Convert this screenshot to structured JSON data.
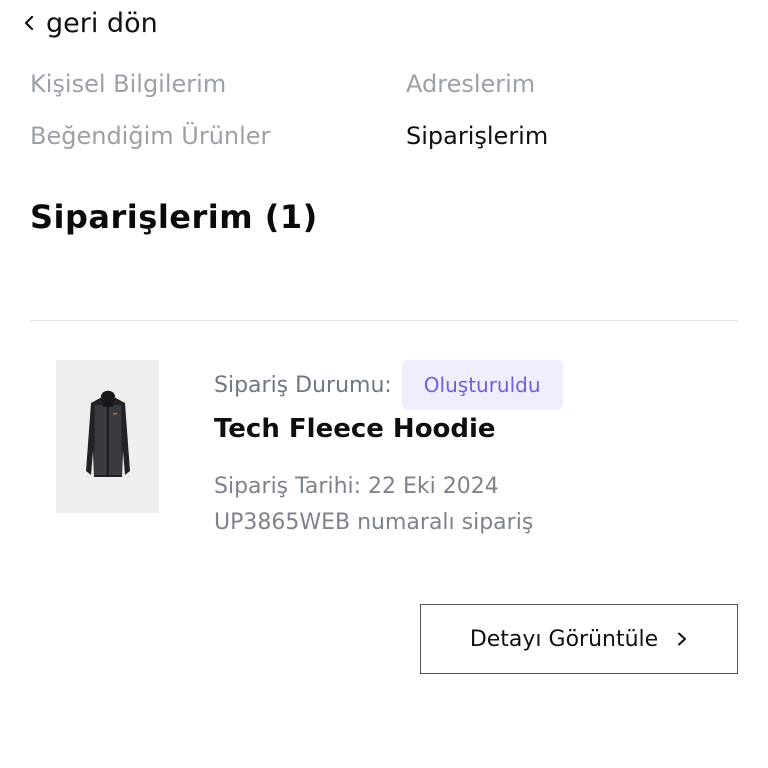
{
  "back": {
    "label": "geri dön",
    "icon": "chevron-left-icon"
  },
  "nav": {
    "items": [
      {
        "label": "Kişisel Bilgilerim",
        "active": false
      },
      {
        "label": "Adreslerim",
        "active": false
      },
      {
        "label": "Beğendiğim Ürünler",
        "active": false
      },
      {
        "label": "Siparişlerim",
        "active": true
      }
    ]
  },
  "page": {
    "title": "Siparişlerim (1)"
  },
  "order": {
    "status_label": "Sipariş Durumu:",
    "status_value": "Oluşturuldu",
    "product_name": "Tech Fleece Hoodie",
    "date_text": "Sipariş Tarihi: 22 Eki 2024",
    "number_text": "UP3865WEB numaralı sipariş",
    "image_icon": "hoodie-product-image",
    "details_button_label": "Detayı Görüntüle",
    "details_button_icon": "chevron-right-icon"
  },
  "colors": {
    "text_primary": "#111111",
    "text_muted": "#9aa1a9",
    "badge_bg": "#f0eefe",
    "badge_text": "#6d5fe0",
    "divider": "#e3e3e3"
  }
}
